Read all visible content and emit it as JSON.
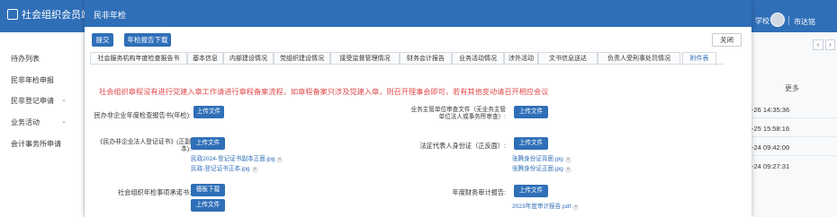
{
  "app": {
    "brand": "社会组织会员端",
    "school_label": "学校",
    "user_label": "市达铭"
  },
  "sidebar": {
    "items": [
      {
        "label": "待办列表"
      },
      {
        "label": "民非年检申报"
      },
      {
        "label": "民非登记申请"
      },
      {
        "label": "业务活动"
      },
      {
        "label": "会计事务所申请"
      }
    ]
  },
  "background_table": {
    "more": "更多",
    "times": [
      "-26 14:35:36",
      "-25 15:58:16",
      "-24 09:42:00",
      "-24 09:27:31"
    ]
  },
  "modal": {
    "title": "民非年检",
    "toolbar": {
      "submit": "提交",
      "download": "年检报告下载",
      "close": "关闭"
    },
    "tabs": [
      {
        "label": "社会服务机构年度检查报告书"
      },
      {
        "label": "基本信息"
      },
      {
        "label": "内部建设情况"
      },
      {
        "label": "党组织建设情况"
      },
      {
        "label": "接受监督管理情况"
      },
      {
        "label": "财务会计报告"
      },
      {
        "label": "业务活动情况"
      },
      {
        "label": "涉外活动"
      },
      {
        "label": "文书信息送达"
      },
      {
        "label": "负责人受刑事处罚情况"
      },
      {
        "label": "附件表"
      }
    ],
    "active_tab": "附件表",
    "notice": "社会组织章程没有进行党建入章工作请进行章程备案流程，如章程备案只涉及党建入章，则召开理事会即可，若有其他变动请召开相应会议",
    "upload_label": "上传文件",
    "template_download": "模板下载",
    "fields": {
      "annual_report": {
        "label": "民办非企业年度检查报告书(年检):"
      },
      "supervisor_review": {
        "label": "业务主管单位审查文件（无业务主管单位法人或事务所审查）:"
      },
      "registration_cert": {
        "label": "《民办非企业法人登记证书》(正副本):",
        "files": [
          "民政2024-登记证书副本正面.jpg",
          "民政-登记证书正本.jpg"
        ]
      },
      "legal_rep_id": {
        "label": "法定代表人身份证（正反面）:",
        "files": [
          "张腾身份证背面.jpg",
          "张腾身份证正面.jpg"
        ]
      },
      "council_resolution": {
        "label": "社会组织年检事项承诺书:"
      },
      "audit_report": {
        "label": "年度财务审计报告:",
        "files": [
          "2023年度审计报告.pdf"
        ]
      }
    }
  }
}
